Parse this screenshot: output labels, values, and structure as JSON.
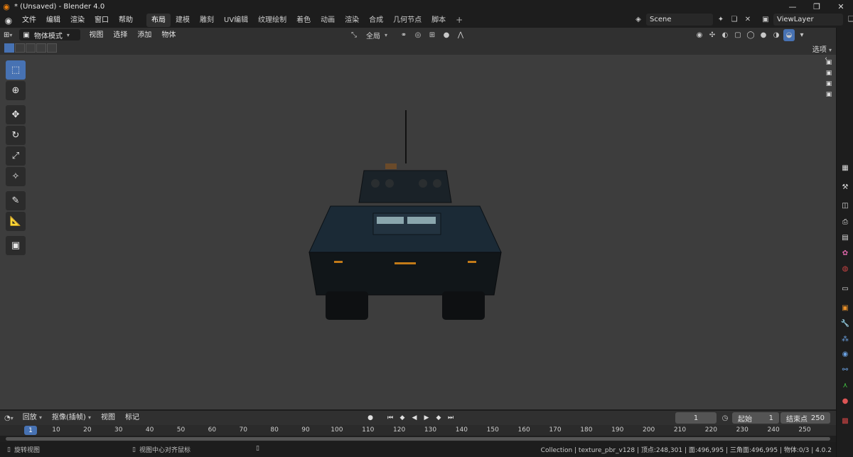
{
  "window": {
    "title": "* (Unsaved) - Blender 4.0",
    "controls": [
      "minimize-icon",
      "maximize-icon",
      "close-icon"
    ]
  },
  "menubar": {
    "items": [
      "文件",
      "编辑",
      "渲染",
      "窗口",
      "帮助"
    ],
    "workspaces": [
      "布局",
      "建模",
      "雕刻",
      "UV编辑",
      "纹理绘制",
      "着色",
      "动画",
      "渲染",
      "合成",
      "几何节点",
      "脚本"
    ],
    "active_workspace": "布局",
    "add_workspace": "+",
    "scene": "Scene",
    "view_layer": "ViewLayer"
  },
  "viewport_header": {
    "mode": "物体模式",
    "menus": [
      "视图",
      "选择",
      "添加",
      "物体"
    ],
    "transform_orientation": "全局",
    "options_label": "选项"
  },
  "tools": [
    "select-box",
    "cursor",
    "move",
    "rotate",
    "scale",
    "transform",
    "annotate",
    "measure",
    "add-cube"
  ],
  "timeline": {
    "menus": [
      "回放",
      "抠像(插帧)",
      "视图",
      "标记"
    ],
    "current_frame": "1",
    "start_label": "起始",
    "start_value": "1",
    "end_label": "结束点",
    "end_value": "250",
    "ruler_ticks": [
      "1",
      "10",
      "20",
      "30",
      "40",
      "50",
      "60",
      "70",
      "80",
      "90",
      "100",
      "110",
      "120",
      "130",
      "140",
      "150",
      "160",
      "170",
      "180",
      "190",
      "200",
      "210",
      "220",
      "230",
      "240",
      "250"
    ]
  },
  "statusbar": {
    "left_action": "旋转视图",
    "middle_action": "视图中心对齐鼠标",
    "stats": "Collection | texture_pbr_v128 | 顶点:248,301 | 面:496,995 | 三角面:496,995 | 物体:0/3 | 4.0.2"
  },
  "colors": {
    "accent": "#4772b3",
    "viewport_bg": "#3d3d3d",
    "header_bg": "#303030",
    "window_bg": "#1d1d1d"
  }
}
